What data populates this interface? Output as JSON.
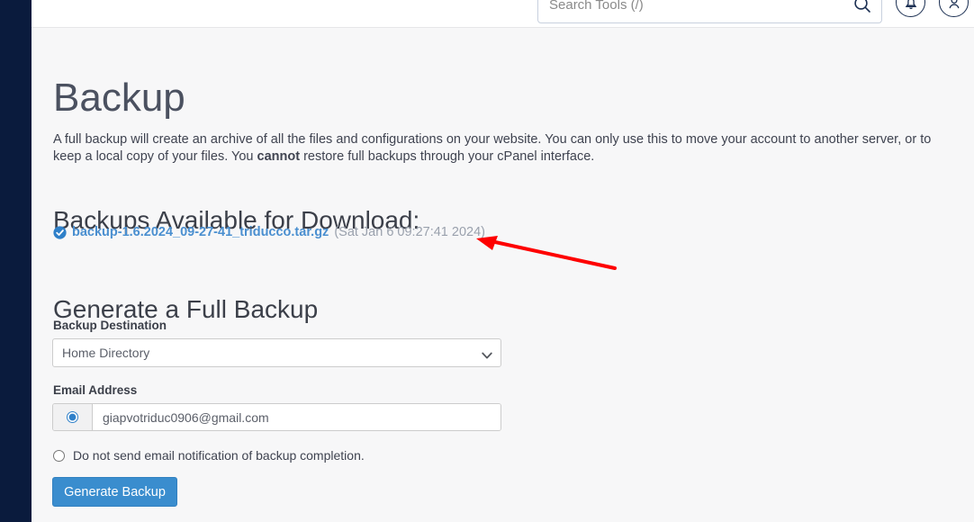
{
  "header": {
    "search": {
      "placeholder": "Search Tools (/)",
      "value": "",
      "icon": "search-icon"
    },
    "notifications_icon": "bell-icon",
    "account_icon": "user-icon"
  },
  "page": {
    "title": "Backup",
    "intro_part1": "A full backup will create an archive of all the files and configurations on your website. You can only use this to move your account to another server, or to keep a local copy of your files. You ",
    "intro_bold": "cannot",
    "intro_part2": " restore full backups through your cPanel interface."
  },
  "downloads": {
    "heading": "Backups Available for Download:",
    "items": [
      {
        "icon": "check-circle-icon",
        "filename": "backup-1.6.2024_09-27-41_triducco.tar.gz",
        "date": "(Sat Jan 6 09:27:41 2024)"
      }
    ]
  },
  "generate": {
    "heading": "Generate a Full Backup",
    "destination_label": "Backup Destination",
    "destination_value": "Home Directory",
    "destination_options": [
      "Home Directory"
    ],
    "email_label": "Email Address",
    "email_value": "giapvotriduc0906@gmail.com",
    "email_selected": true,
    "no_email_label": "Do not send email notification of backup completion.",
    "no_email_selected": false,
    "submit_label": "Generate Backup"
  },
  "colors": {
    "sidebar": "#0a1b3d",
    "link": "#4a8fd0",
    "button": "#3a8dce",
    "check": "#2f80c9",
    "annotation": "#fe0000",
    "content_bg": "#f7f7f8"
  }
}
